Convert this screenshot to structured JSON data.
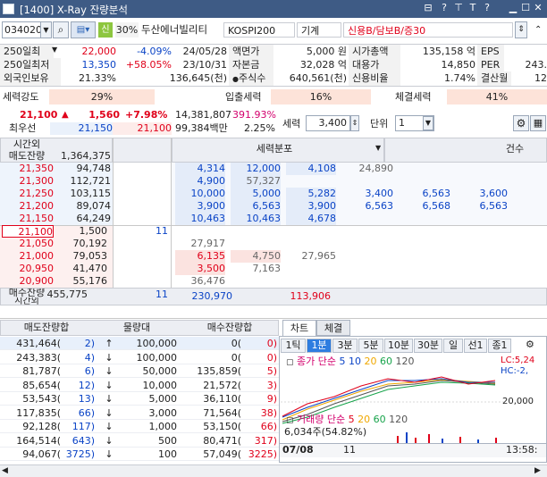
{
  "window": {
    "title": "[1400] X-Ray 잔량분석",
    "controls": [
      "-",
      "?",
      "T",
      "?"
    ]
  },
  "toolbar": {
    "code": "034020",
    "market_tag": "신",
    "rate": "30%",
    "name": "두산에너빌리티",
    "index": "KOSPI200",
    "sector": "기계",
    "credit": "신용B/담보B/증30"
  },
  "info": {
    "rows": [
      [
        "250일최",
        "22,000",
        "-4.09%",
        "24/05/28",
        "액면가",
        "5,000 원",
        "시가총액",
        "135,158 억",
        "EPS",
        ""
      ],
      [
        "250일최저",
        "13,350",
        "+58.05%",
        "23/10/31",
        "자본금",
        "32,028 억",
        "대용가",
        "14,850",
        "PER",
        "243."
      ],
      [
        "외국인보유",
        "21.33%",
        "136,645(천)",
        "",
        "주식수",
        "640,561(천)",
        "신용비율",
        "1.74%",
        "결산월",
        "12"
      ]
    ]
  },
  "strength": {
    "label1": "세력강도",
    "val1": "29%",
    "label2": "입출세력",
    "val2": "16%",
    "label3": "체결세력",
    "val3": "41%"
  },
  "price": {
    "current": "21,100",
    "arrow": "▲",
    "change": "1,560",
    "pct": "+7.98%",
    "volume": "14,381,807",
    "vol_pct": "391.93%",
    "best_label": "최우선",
    "best_ask": "21,150",
    "best_bid": "21,100",
    "amount": "99,384백만",
    "amt_pct": "2.25%",
    "force_label": "세력",
    "force_val": "3,400",
    "unit_label": "단위",
    "unit_val": "1"
  },
  "orderbook": {
    "col_label": "시간외",
    "ask_label": "매도잔량",
    "ask_total": "1,364,375",
    "dist_label": "세력분포",
    "count_label": "건수",
    "asks": [
      {
        "price": "21,350",
        "qty": "94,748",
        "d": [
          "4,314",
          "12,000",
          "4,108",
          "24,890",
          "",
          ""
        ]
      },
      {
        "price": "21,300",
        "qty": "112,721",
        "d": [
          "4,900",
          "57,327",
          "",
          "",
          "",
          ""
        ]
      },
      {
        "price": "21,250",
        "qty": "103,115",
        "d": [
          "10,000",
          "5,000",
          "5,282",
          "3,400",
          "6,563",
          "3,600"
        ]
      },
      {
        "price": "21,200",
        "qty": "89,074",
        "d": [
          "3,900",
          "6,563",
          "3,900",
          "6,563",
          "6,568",
          "6,563"
        ]
      },
      {
        "price": "21,150",
        "qty": "64,249",
        "d": [
          "10,463",
          "10,463",
          "4,678",
          "",
          "",
          ""
        ]
      }
    ],
    "bids": [
      {
        "price": "21,100",
        "qty": "1,500",
        "cnt": "11",
        "d": [
          "",
          "",
          "",
          "",
          "",
          ""
        ]
      },
      {
        "price": "21,050",
        "qty": "70,192",
        "cnt": "",
        "d": [
          "27,917",
          "",
          "",
          "",
          "",
          ""
        ]
      },
      {
        "price": "21,000",
        "qty": "79,053",
        "cnt": "",
        "d": [
          "6,135",
          "4,750",
          "27,965",
          "",
          "",
          ""
        ]
      },
      {
        "price": "20,950",
        "qty": "41,470",
        "cnt": "",
        "d": [
          "3,500",
          "7,163",
          "",
          "",
          "",
          ""
        ]
      },
      {
        "price": "20,900",
        "qty": "55,176",
        "cnt": "",
        "d": [
          "36,476",
          "",
          "",
          "",
          "",
          ""
        ]
      }
    ],
    "bid_label": "매수잔량",
    "bid_label2": "시간외",
    "bid_total": "455,775",
    "bid_cnt": "11",
    "sum_blue": "230,970",
    "sum_red": "113,906"
  },
  "volume_table": {
    "headers": [
      "매도잔량합",
      "물량대",
      "매수잔량합"
    ],
    "rows": [
      [
        "431,464(",
        "2)",
        "↑",
        "100,000",
        "0(",
        "0)"
      ],
      [
        "243,383(",
        "4)",
        "↓",
        "100,000",
        "0(",
        "0)"
      ],
      [
        "81,787(",
        "6)",
        "↓",
        "50,000",
        "135,859(",
        "5)"
      ],
      [
        "85,654(",
        "12)",
        "↓",
        "10,000",
        "21,572(",
        "3)"
      ],
      [
        "53,543(",
        "13)",
        "↓",
        "5,000",
        "36,110(",
        "9)"
      ],
      [
        "117,835(",
        "66)",
        "↓",
        "3,000",
        "71,564(",
        "38)"
      ],
      [
        "92,128(",
        "117)",
        "↓",
        "1,000",
        "53,150(",
        "66)"
      ],
      [
        "164,514(",
        "643)",
        "↓",
        "500",
        "80,471(",
        "317)"
      ],
      [
        "94,067(",
        "3725)",
        "↓",
        "100",
        "57,049(",
        "3225)"
      ]
    ]
  },
  "chart_panel": {
    "tabs": [
      "차트",
      "체결"
    ],
    "timeframes": [
      "1틱",
      "1분",
      "3분",
      "5분",
      "10분",
      "30분",
      "일",
      "선1",
      "종1"
    ],
    "price_legend": {
      "label": "종가 단순",
      "ma": [
        "5",
        "10",
        "20",
        "60",
        "120"
      ]
    },
    "volume_legend": {
      "label": "거래량 단순",
      "ma": [
        "5",
        "20",
        "60",
        "120"
      ]
    },
    "y_tick": "20,000",
    "vol_text": "6,034주(54.82%)",
    "hi": "LC:5,24",
    "lo": "HC:-2,",
    "x_labels": [
      "07/08",
      "11",
      "13:58:"
    ]
  },
  "colors": {
    "accent": "#3e5b85",
    "up": "#e0001a",
    "down": "#0a43c6",
    "ma5": "#e0001a",
    "ma10": "#0a43c6",
    "ma20": "#f0a800",
    "ma60": "#16a34a",
    "ma120": "#555555"
  }
}
